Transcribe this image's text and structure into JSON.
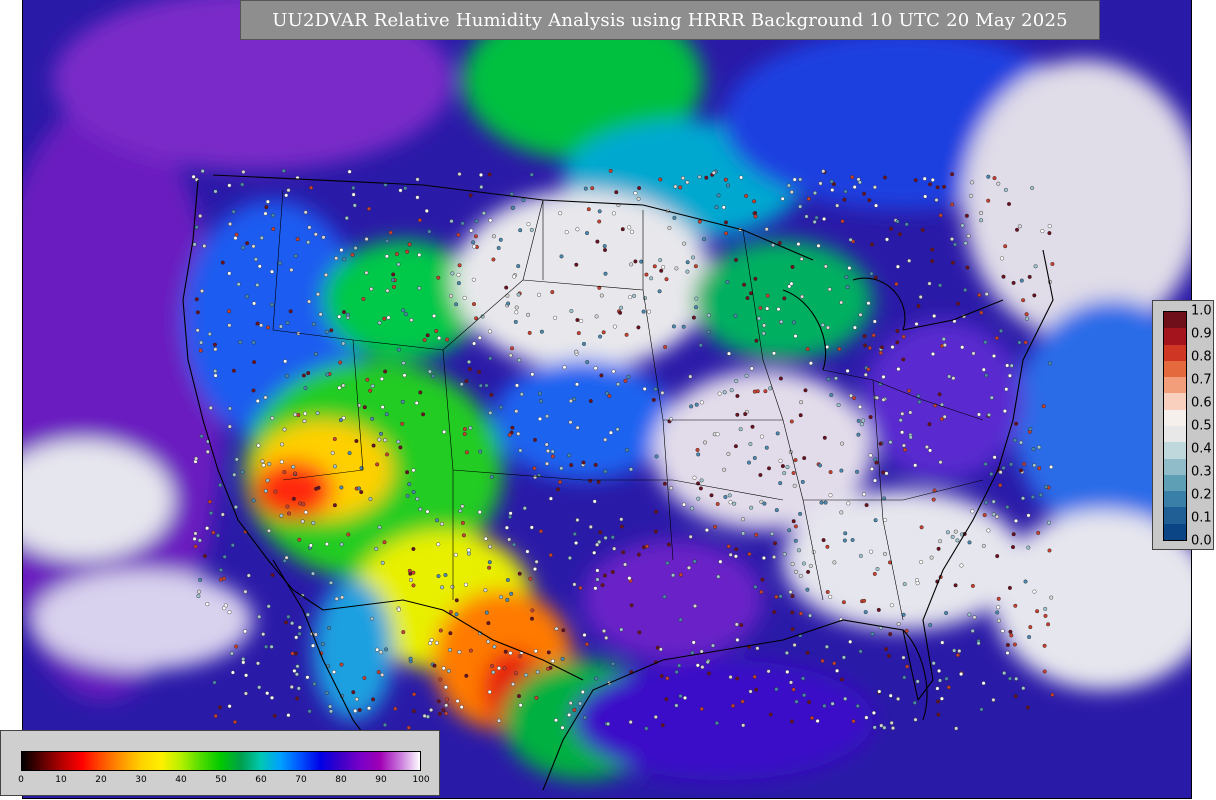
{
  "title": "UU2DVAR Relative Humidity Analysis using HRRR Background 10 UTC 20 May 2025",
  "humidity_colorbar": {
    "ticks": [
      "0",
      "10",
      "20",
      "30",
      "40",
      "50",
      "60",
      "70",
      "80",
      "90",
      "100"
    ],
    "colors": [
      "#000000",
      "#5a0000",
      "#b40000",
      "#ff0000",
      "#ff5000",
      "#ff9600",
      "#ffd200",
      "#fff000",
      "#b4f000",
      "#50dc00",
      "#00c800",
      "#00a04b",
      "#00c8b4",
      "#00a0ff",
      "#0050ff",
      "#0000e6",
      "#3c00c8",
      "#7800c8",
      "#a000b4",
      "#c878dc",
      "#ffffff"
    ]
  },
  "increment_colorbar": {
    "ticks": [
      "1.0",
      "0.9",
      "0.8",
      "0.7",
      "0.6",
      "0.5",
      "0.4",
      "0.3",
      "0.2",
      "0.1",
      "0.0"
    ],
    "colors": [
      "#6e0f1a",
      "#a3141c",
      "#cf3624",
      "#e46a3e",
      "#f29e7a",
      "#f9cfbe",
      "#f6f0ec",
      "#e8e8e8",
      "#bfd8dc",
      "#8fbcc8",
      "#5f9fb5",
      "#3a7fa8",
      "#1f5f96",
      "#0c4585"
    ]
  },
  "map_colors": {
    "ocean_humid": "#3c10c8",
    "very_humid": "#e8e8ec",
    "moist": "#7a2cc8",
    "mid": "#1060f0",
    "green": "#00c040",
    "yellow": "#e8f000",
    "orange": "#ff8c00",
    "red": "#e81010",
    "outline": "#000000"
  }
}
